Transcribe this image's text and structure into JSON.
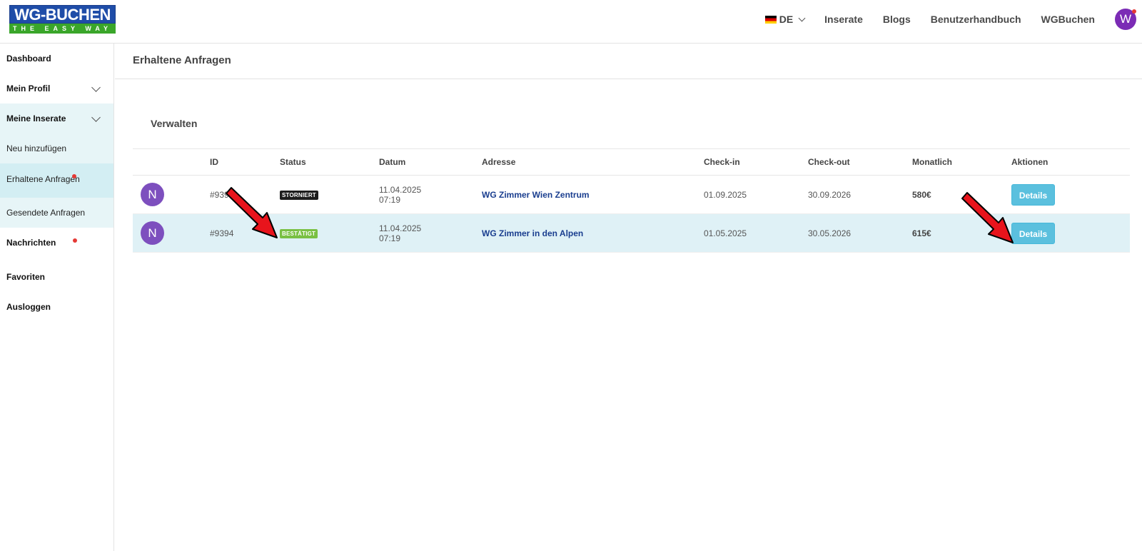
{
  "header": {
    "logo_text": "WG-BUCHEN",
    "logo_tagline": "THE EASY WAY",
    "language": "DE",
    "nav": [
      "Inserate",
      "Blogs",
      "Benutzerhandbuch",
      "WGBuchen"
    ],
    "user_initial": "W"
  },
  "sidebar": {
    "dashboard": "Dashboard",
    "profile": "Mein Profil",
    "listings": "Meine Inserate",
    "add_new": "Neu hinzufügen",
    "received": "Erhaltene Anfragen",
    "sent": "Gesendete Anfragen",
    "messages": "Nachrichten",
    "favorites": "Favoriten",
    "logout": "Ausloggen"
  },
  "main": {
    "page_title": "Erhaltene Anfragen",
    "section_title": "Verwalten",
    "columns": [
      "",
      "ID",
      "Status",
      "Datum",
      "Adresse",
      "Check-in",
      "Check-out",
      "Monatlich",
      "Aktionen"
    ],
    "rows": [
      {
        "avatar": "N",
        "id": "#9395",
        "status": "STORNIERT",
        "date": "11.04.2025",
        "time": "07:19",
        "address": "WG Zimmer Wien Zentrum",
        "checkin": "01.09.2025",
        "checkout": "30.09.2026",
        "monthly": "580€",
        "action": "Details"
      },
      {
        "avatar": "N",
        "id": "#9394",
        "status": "BESTÄTIGT",
        "date": "11.04.2025",
        "time": "07:19",
        "address": "WG Zimmer in den Alpen",
        "checkin": "01.05.2025",
        "checkout": "30.05.2026",
        "monthly": "615€",
        "action": "Details"
      }
    ]
  },
  "colors": {
    "accent": "#5bc0de",
    "highlight_row": "#dff1f6",
    "confirmed": "#79c043",
    "cancelled": "#1d1d1d",
    "annotation_arrow": "#e8141c"
  }
}
